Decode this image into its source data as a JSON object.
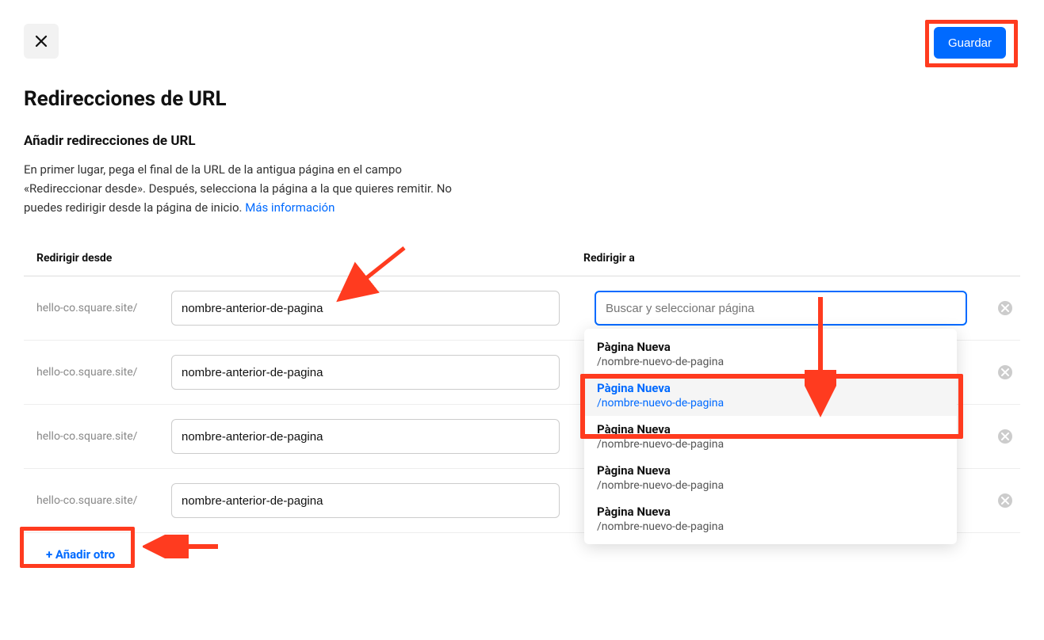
{
  "header": {
    "close_label": "×",
    "save_label": "Guardar"
  },
  "page_title": "Redirecciones de URL",
  "section": {
    "subtitle": "Añadir redirecciones de URL",
    "desc_1": "En primer lugar, pega el final de la URL de la antigua página en el campo «Redireccionar desde». Después, selecciona la página a la que quieres remitir. No puedes redirigir desde la página de inicio. ",
    "more_link": "Más información"
  },
  "columns": {
    "from": "Redirigir desde",
    "to": "Redirigir a"
  },
  "site_base": "hello-co.square.site/",
  "rows": [
    {
      "from": "nombre-anterior-de-pagina"
    },
    {
      "from": "nombre-anterior-de-pagina"
    },
    {
      "from": "nombre-anterior-de-pagina"
    },
    {
      "from": "nombre-anterior-de-pagina"
    }
  ],
  "search_placeholder": "Buscar y seleccionar página",
  "dropdown": [
    {
      "title": "Pàgina Nueva",
      "path": "/nombre-nuevo-de-pagina",
      "selected": false
    },
    {
      "title": "Pàgina Nueva",
      "path": "/nombre-nuevo-de-pagina",
      "selected": true
    },
    {
      "title": "Pàgina Nueva",
      "path": "/nombre-nuevo-de-pagina",
      "selected": false
    },
    {
      "title": "Pàgina Nueva",
      "path": "/nombre-nuevo-de-pagina",
      "selected": false
    },
    {
      "title": "Pàgina Nueva",
      "path": "/nombre-nuevo-de-pagina",
      "selected": false
    }
  ],
  "add_button": "+ Añadir otro"
}
